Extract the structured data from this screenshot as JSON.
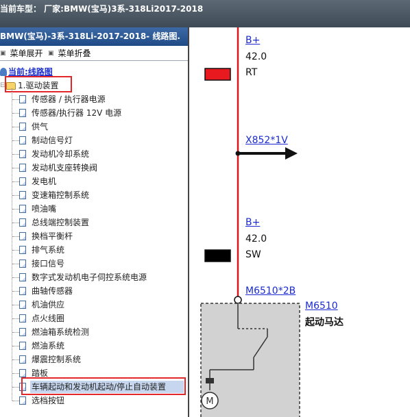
{
  "window": {
    "title": "当前车型：  厂家:BMW(宝马)3系-318Li2017-2018"
  },
  "left_panel": {
    "header": "BMW(宝马)-3系-318Li-2017-2018- 线路图.",
    "menu": {
      "expand_label": "菜单展开",
      "collapse_label": "菜单折叠"
    },
    "root_label": "当前:线路图",
    "folder_label": "1.驱动装置",
    "items": [
      "传感器 / 执行器电源",
      "传感器/执行器 12V 电源",
      "供气",
      "制动信号灯",
      "发动机冷却系统",
      "发动机支座转换阀",
      "发电机",
      "变速箱控制系统",
      "喷油嘴",
      "总线端控制装置",
      "换档平衡杆",
      "排气系统",
      "接口信号",
      "数字式发动机电子伺控系统电源",
      "曲轴传感器",
      "机油供应",
      "点火线圈",
      "燃油箱系统检测",
      "燃油系统",
      "爆震控制系统",
      "踏板",
      "车辆起动和发动机起动/停止自动装置",
      "选档按钮"
    ],
    "selected_index": 21
  },
  "diagram": {
    "wire1": {
      "label": "B+",
      "gauge": "42.0",
      "color_code": "RT",
      "color_hex": "#e8191f"
    },
    "connector": {
      "label": "X852*1V"
    },
    "wire2": {
      "label": "B+",
      "gauge": "42.0",
      "color_code": "SW",
      "color_hex": "#000000"
    },
    "pin": {
      "label": "M6510*2B"
    },
    "component": {
      "code": "M6510",
      "name": "起动马达",
      "motor_symbol": "M"
    }
  },
  "colors": {
    "wire": "#d8151c",
    "highlight": "#e3262a",
    "link": "#1a2ad0"
  }
}
